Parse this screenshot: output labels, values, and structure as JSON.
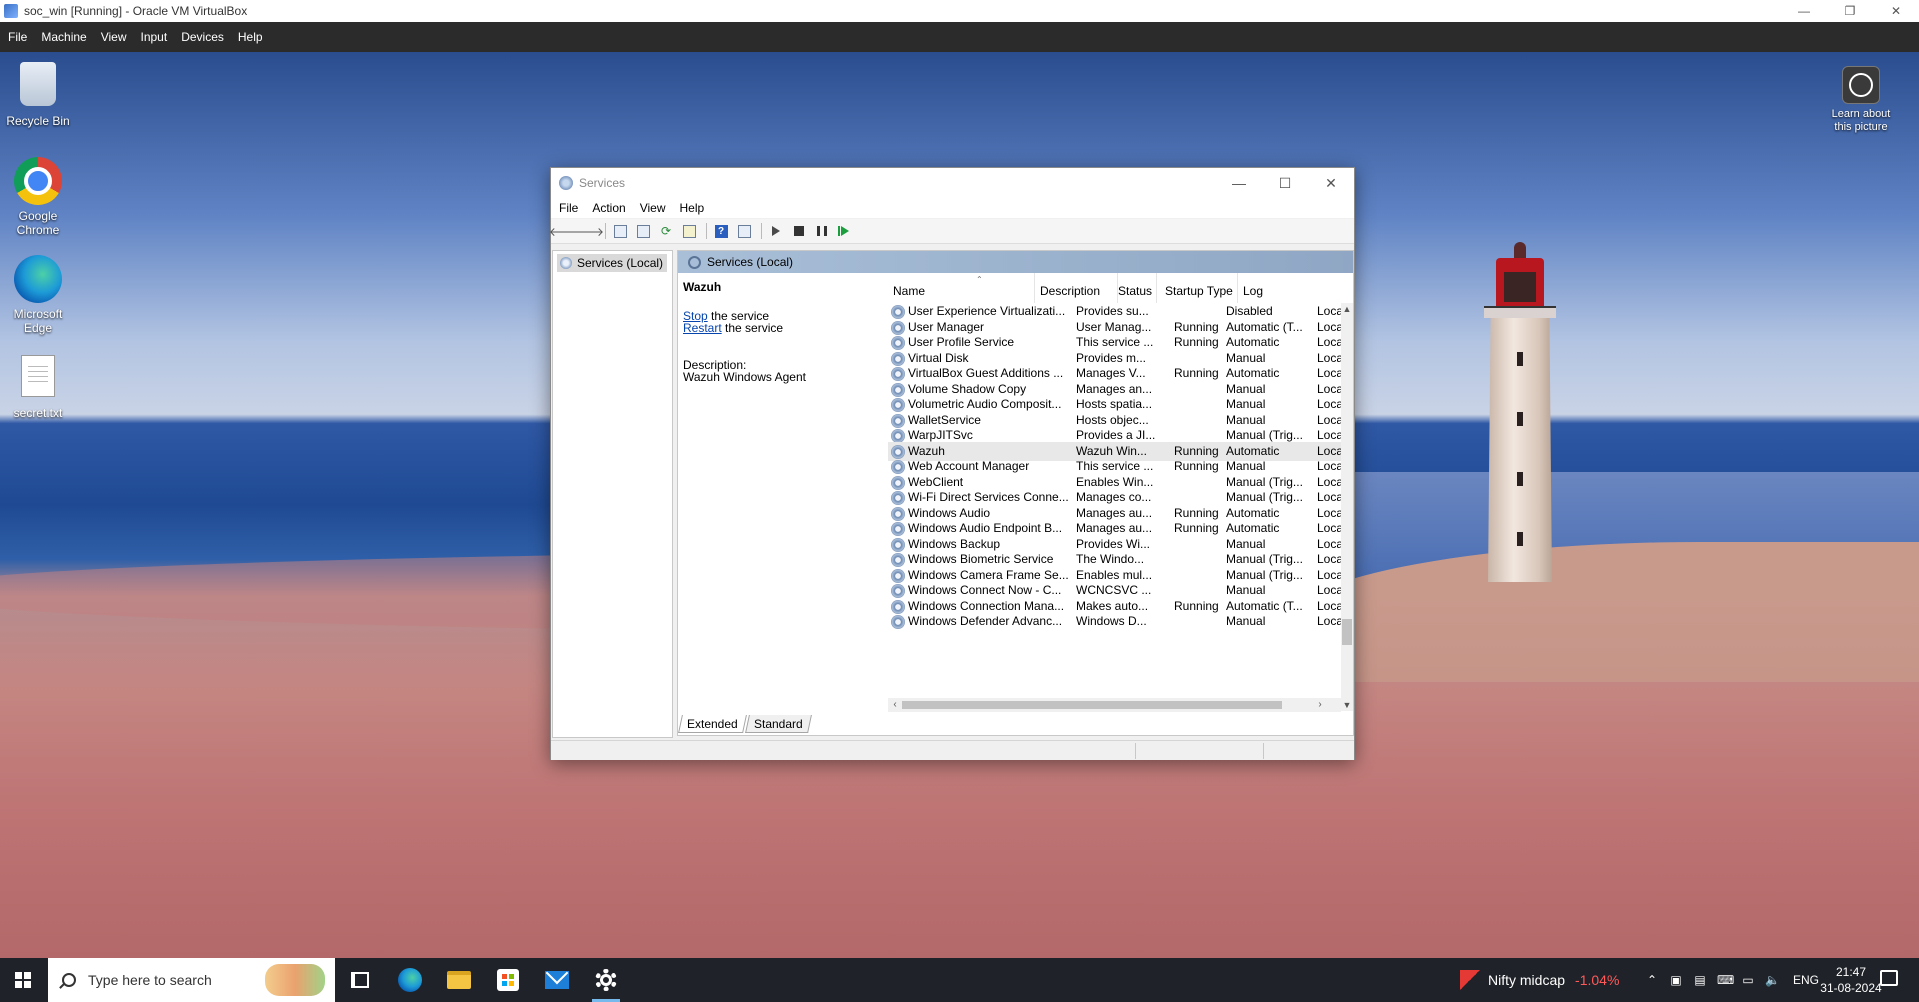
{
  "host": {
    "title": "soc_win [Running] - Oracle VM VirtualBox",
    "menu": [
      "File",
      "Machine",
      "View",
      "Input",
      "Devices",
      "Help"
    ],
    "controls": {
      "minimize": "—",
      "restore": "❐",
      "close": "✕"
    }
  },
  "desktop": {
    "icons": [
      {
        "label": "Recycle Bin",
        "icon": "recycle-bin-icon"
      },
      {
        "label": "Google Chrome",
        "icon": "chrome-icon"
      },
      {
        "label": "Microsoft Edge",
        "icon": "edge-icon"
      },
      {
        "label": "secret.txt",
        "icon": "text-file-icon"
      }
    ],
    "learn_picture": "Learn about this picture"
  },
  "services": {
    "title": "Services",
    "menu": [
      "File",
      "Action",
      "View",
      "Help"
    ],
    "controls": {
      "minimize": "—",
      "maximize": "☐",
      "close": "✕"
    },
    "tree_item": "Services (Local)",
    "header": "Services (Local)",
    "detail": {
      "title": "Wazuh",
      "stop_link": "Stop",
      "stop_rest": "the service",
      "restart_link": "Restart",
      "restart_rest": "the service",
      "description_label": "Description:",
      "description": "Wazuh Windows Agent"
    },
    "columns": [
      "Name",
      "Description",
      "Status",
      "Startup Type",
      "Log"
    ],
    "rows": [
      {
        "name": "User Experience Virtualizati...",
        "desc": "Provides su...",
        "status": "",
        "startup": "Disabled",
        "log": "Loca"
      },
      {
        "name": "User Manager",
        "desc": "User Manag...",
        "status": "Running",
        "startup": "Automatic (T...",
        "log": "Loca"
      },
      {
        "name": "User Profile Service",
        "desc": "This service ...",
        "status": "Running",
        "startup": "Automatic",
        "log": "Loca"
      },
      {
        "name": "Virtual Disk",
        "desc": "Provides m...",
        "status": "",
        "startup": "Manual",
        "log": "Loca"
      },
      {
        "name": "VirtualBox Guest Additions ...",
        "desc": "Manages V...",
        "status": "Running",
        "startup": "Automatic",
        "log": "Loca"
      },
      {
        "name": "Volume Shadow Copy",
        "desc": "Manages an...",
        "status": "",
        "startup": "Manual",
        "log": "Loca"
      },
      {
        "name": "Volumetric Audio Composit...",
        "desc": "Hosts spatia...",
        "status": "",
        "startup": "Manual",
        "log": "Loca"
      },
      {
        "name": "WalletService",
        "desc": "Hosts objec...",
        "status": "",
        "startup": "Manual",
        "log": "Loca"
      },
      {
        "name": "WarpJITSvc",
        "desc": "Provides a JI...",
        "status": "",
        "startup": "Manual (Trig...",
        "log": "Loca"
      },
      {
        "name": "Wazuh",
        "desc": "Wazuh Win...",
        "status": "Running",
        "startup": "Automatic",
        "log": "Loca",
        "selected": true
      },
      {
        "name": "Web Account Manager",
        "desc": "This service ...",
        "status": "Running",
        "startup": "Manual",
        "log": "Loca"
      },
      {
        "name": "WebClient",
        "desc": "Enables Win...",
        "status": "",
        "startup": "Manual (Trig...",
        "log": "Loca"
      },
      {
        "name": "Wi-Fi Direct Services Conne...",
        "desc": "Manages co...",
        "status": "",
        "startup": "Manual (Trig...",
        "log": "Loca"
      },
      {
        "name": "Windows Audio",
        "desc": "Manages au...",
        "status": "Running",
        "startup": "Automatic",
        "log": "Loca"
      },
      {
        "name": "Windows Audio Endpoint B...",
        "desc": "Manages au...",
        "status": "Running",
        "startup": "Automatic",
        "log": "Loca"
      },
      {
        "name": "Windows Backup",
        "desc": "Provides Wi...",
        "status": "",
        "startup": "Manual",
        "log": "Loca"
      },
      {
        "name": "Windows Biometric Service",
        "desc": "The Windo...",
        "status": "",
        "startup": "Manual (Trig...",
        "log": "Loca"
      },
      {
        "name": "Windows Camera Frame Se...",
        "desc": "Enables mul...",
        "status": "",
        "startup": "Manual (Trig...",
        "log": "Loca"
      },
      {
        "name": "Windows Connect Now - C...",
        "desc": "WCNCSVC ...",
        "status": "",
        "startup": "Manual",
        "log": "Loca"
      },
      {
        "name": "Windows Connection Mana...",
        "desc": "Makes auto...",
        "status": "Running",
        "startup": "Automatic (T...",
        "log": "Loca"
      },
      {
        "name": "Windows Defender Advanc...",
        "desc": "Windows D...",
        "status": "",
        "startup": "Manual",
        "log": "Loca"
      }
    ],
    "tabs": [
      "Extended",
      "Standard"
    ]
  },
  "taskbar": {
    "search_placeholder": "Type here to search",
    "widget_name": "Nifty midcap",
    "widget_value": "-1.04%",
    "language": "ENG",
    "time": "21:47",
    "date": "31-08-2024"
  }
}
